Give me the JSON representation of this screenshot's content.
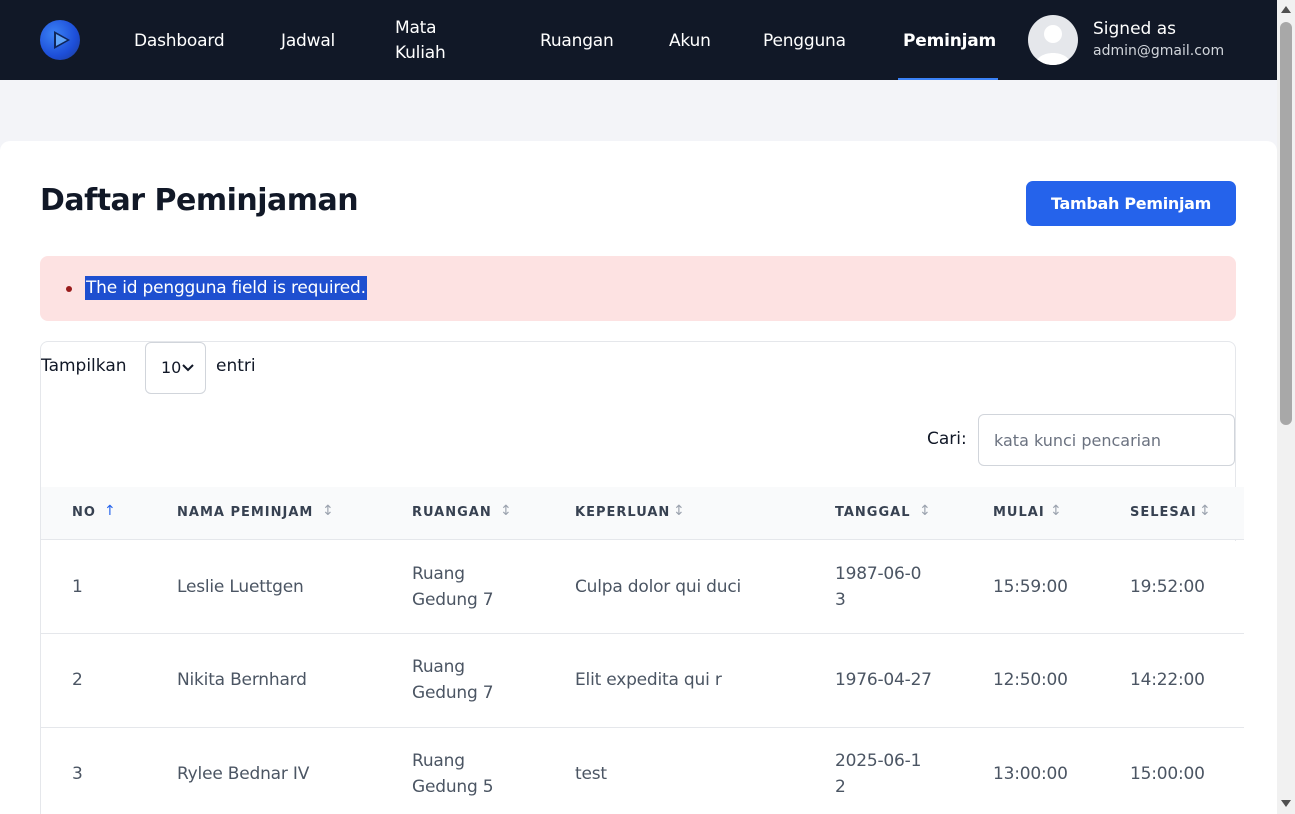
{
  "nav": {
    "links": [
      "Dashboard",
      "Jadwal",
      "Mata Kuliah",
      "Ruangan",
      "Akun",
      "Pengguna",
      "Peminjam"
    ],
    "active": "Peminjam",
    "user": {
      "signed_as": "Signed as",
      "email": "admin@gmail.com"
    }
  },
  "page": {
    "title": "Daftar Peminjaman",
    "add_button": "Tambah Peminjam",
    "alert_message": "The id pengguna field is required."
  },
  "table_controls": {
    "show_label": "Tampilkan",
    "page_size": "10",
    "entries_label": "entri",
    "search_label": "Cari:",
    "search_placeholder": "kata kunci pencarian"
  },
  "table": {
    "columns": [
      "NO",
      "NAMA PEMINJAM",
      "RUANGAN",
      "KEPERLUAN",
      "TANGGAL",
      "MULAI",
      "SELESAI"
    ],
    "sorted_column": "NO",
    "rows": [
      {
        "no": "1",
        "nama": "Leslie Luettgen",
        "ruangan": "Ruang Gedung 7",
        "keperluan": "Culpa dolor qui duci",
        "tanggal": "1987-06-03",
        "mulai": "15:59:00",
        "selesai": "19:52:00"
      },
      {
        "no": "2",
        "nama": "Nikita Bernhard",
        "ruangan": "Ruang Gedung 7",
        "keperluan": "Elit expedita qui r",
        "tanggal": "1976-04-27",
        "mulai": "12:50:00",
        "selesai": "14:22:00"
      },
      {
        "no": "3",
        "nama": "Rylee Bednar IV",
        "ruangan": "Ruang Gedung 5",
        "keperluan": "test",
        "tanggal": "2025-06-12",
        "mulai": "13:00:00",
        "selesai": "15:00:00"
      }
    ]
  },
  "colors": {
    "navbar": "#111827",
    "primary": "#2563eb",
    "alert_bg": "#fde2e2"
  },
  "icons": {
    "logo": "play-logo-icon",
    "avatar": "user-avatar-icon",
    "sort": "sort-arrows-icon",
    "select": "chevron-down-icon"
  }
}
